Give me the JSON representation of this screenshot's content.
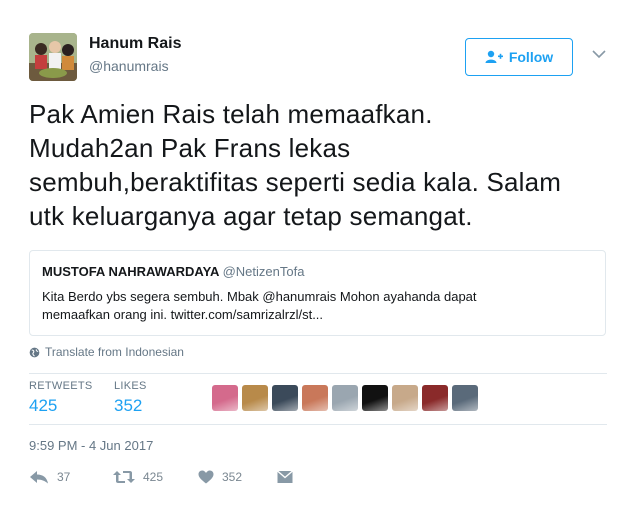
{
  "user": {
    "name": "Hanum Rais",
    "handle": "@hanumrais"
  },
  "follow_button": {
    "label": "Follow",
    "icon": "add-user-icon"
  },
  "tweet": {
    "lines": [
      "Pak Amien Rais telah memaafkan.",
      "Mudah2an Pak Frans lekas",
      "sembuh,beraktifitas seperti sedia kala. Salam",
      "utk keluarganya agar tetap semangat."
    ]
  },
  "quoted_tweet": {
    "name": "MUSTOFA NAHRAWARDAYA",
    "handle": "@NetizenTofa",
    "lines": [
      "Kita Berdo ybs segera sembuh.  Mbak @hanumrais Mohon ayahanda dapat",
      "memaafkan orang ini. twitter.com/samrizalrzl/st..."
    ]
  },
  "translate": {
    "label": "Translate from Indonesian",
    "icon": "globe-icon"
  },
  "stats": {
    "retweets_label": "RETWEETS",
    "retweets_value": "425",
    "likes_label": "LIKES",
    "likes_value": "352"
  },
  "timestamp": "9:59 PM - 4 Jun 2017",
  "actions": {
    "reply_count": "37",
    "retweet_count": "425",
    "like_count": "352"
  },
  "colors": {
    "accent": "#1da1f2",
    "muted": "#657786",
    "border": "#e1e8ed",
    "text": "#14171a"
  },
  "liker_avatars": [
    {
      "name": "liker-avatar-1",
      "color": "#d46a8c"
    },
    {
      "name": "liker-avatar-2",
      "color": "#b88a4a"
    },
    {
      "name": "liker-avatar-3",
      "color": "#3b4a5a"
    },
    {
      "name": "liker-avatar-4",
      "color": "#c9785a"
    },
    {
      "name": "liker-avatar-5",
      "color": "#9aa6b0"
    },
    {
      "name": "liker-avatar-6",
      "color": "#111111"
    },
    {
      "name": "liker-avatar-7",
      "color": "#c7a98a"
    },
    {
      "name": "liker-avatar-8",
      "color": "#8a2a2a"
    },
    {
      "name": "liker-avatar-9",
      "color": "#5a6a7a"
    }
  ]
}
